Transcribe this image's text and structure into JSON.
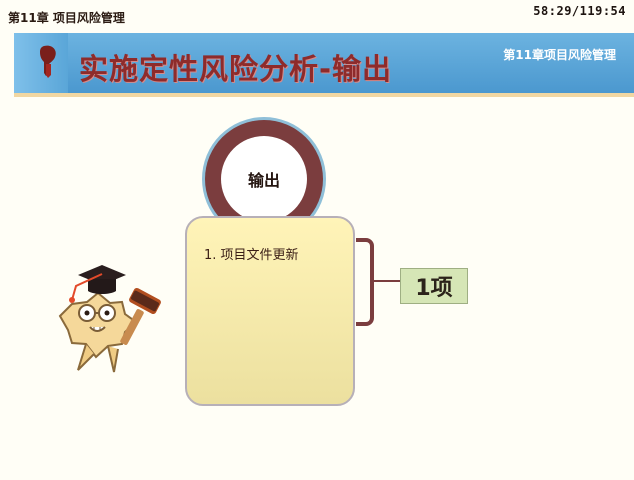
{
  "chapter_title": "第11章 项目风险管理",
  "timer": "58:29/119:54",
  "banner": {
    "title": "实施定性风险分析-输出",
    "subtitle": "第11章项目风险管理"
  },
  "diagram": {
    "circle_label": "输出",
    "card_items": [
      "1. 项目文件更新"
    ],
    "count_label": "1项"
  },
  "icons": [
    "tassel-icon",
    "mascot-icon",
    "gavel-icon"
  ],
  "colors": {
    "banner": "#5aa6d8",
    "title": "#8e2b2b",
    "ring": "#7b3d3e",
    "card": "#fff4b8",
    "count_box": "#d6e6b6"
  }
}
